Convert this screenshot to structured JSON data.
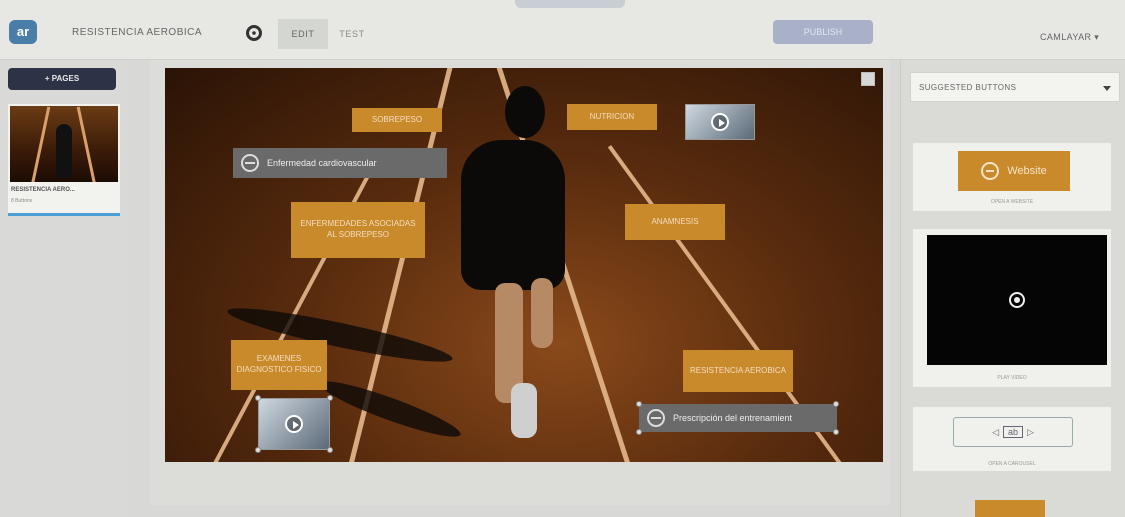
{
  "header": {
    "logo_text": "ar",
    "project_title": "RESISTENCIA AEROBICA",
    "tabs": [
      {
        "label": "EDIT",
        "active": true
      },
      {
        "label": "TEST",
        "active": false
      }
    ],
    "publish_label": "PUBLISH",
    "user_menu": "CAMLAYAR ▾",
    "settings_icon": "gear-icon"
  },
  "pages": {
    "add_label": "+ PAGES",
    "items": [
      {
        "name": "RESISTENCIA AERO...",
        "sub": "8 Buttons"
      }
    ]
  },
  "scene": {
    "badges": [
      {
        "id": "sobrepeso",
        "text": "SOBREPESO"
      },
      {
        "id": "nutricion",
        "text": "NUTRICION"
      },
      {
        "id": "enfermedades",
        "text": "ENFERMEDADES ASOCIADAS AL SOBREPESO"
      },
      {
        "id": "anamnesis",
        "text": "ANAMNESIS"
      },
      {
        "id": "examenes",
        "text": "EXAMENES DIAGNOSTICO FISICO"
      },
      {
        "id": "resistencia",
        "text": "RESISTENCIA AEROBICA"
      }
    ],
    "pills": [
      {
        "id": "cardio",
        "text": "Enfermedad cardiovascular",
        "icon": "globe-icon"
      },
      {
        "id": "prescripcion",
        "text": "Prescripción del entrenamient",
        "icon": "globe-icon"
      }
    ]
  },
  "right": {
    "dropdown_label": "SUGGESTED BUTTONS",
    "website_label": "Website",
    "website_caption": "OPEN A WEBSITE",
    "video_caption": "PLAY VIDEO",
    "carousel_label": "ab",
    "carousel_caption": "OPEN A CAROUSEL"
  },
  "colors": {
    "accent_orange": "#c88a2a",
    "nav_dark": "#2c3347",
    "publish_bg": "#a9b1c8",
    "selection_blue": "#4b9fd6"
  }
}
